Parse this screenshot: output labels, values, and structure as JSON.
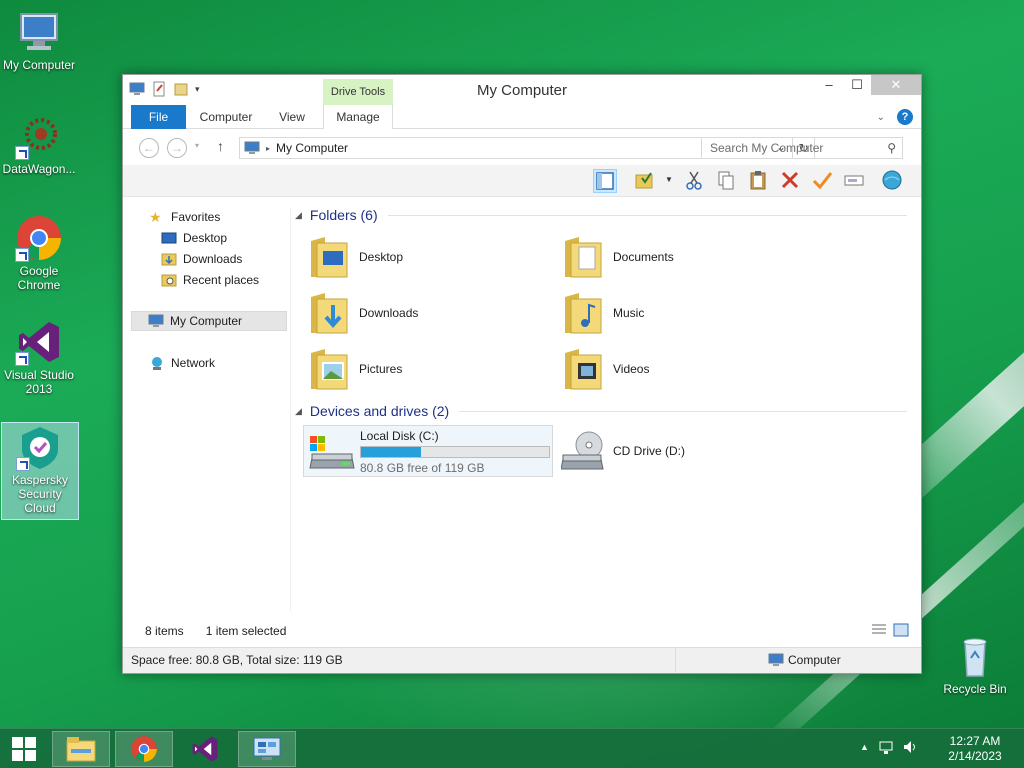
{
  "desktop": {
    "icons": [
      {
        "label": "My Computer"
      },
      {
        "label": "DataWagon..."
      },
      {
        "label": "Google Chrome"
      },
      {
        "label": "Visual Studio 2013"
      },
      {
        "label": "Kaspersky Security Cloud"
      },
      {
        "label": "Recycle Bin"
      }
    ]
  },
  "window": {
    "title": "My Computer",
    "contextual_tab_group": "Drive Tools",
    "ribbon_tabs": [
      "File",
      "Computer",
      "View",
      "Manage"
    ],
    "close_glyph": "✕",
    "maximize_glyph": "☐",
    "minimize_glyph": "–",
    "address": {
      "path": "My Computer"
    },
    "search": {
      "placeholder": "Search My Computer"
    },
    "nav": {
      "favorites": "Favorites",
      "favorites_items": [
        "Desktop",
        "Downloads",
        "Recent places"
      ],
      "my_computer": "My Computer",
      "network": "Network"
    },
    "groups": {
      "folders_header": "Folders (6)",
      "folders": [
        "Desktop",
        "Documents",
        "Downloads",
        "Music",
        "Pictures",
        "Videos"
      ],
      "devices_header": "Devices and drives (2)",
      "drives": [
        {
          "name": "Local Disk (C:)",
          "free_text": "80.8 GB free of 119 GB",
          "used_fraction": 0.32
        },
        {
          "name": "CD Drive (D:)"
        }
      ]
    },
    "status": {
      "items": "8 items",
      "selected": "1 item selected"
    },
    "details": {
      "space": "Space free: 80.8 GB, Total size: 119 GB",
      "location": "Computer"
    }
  },
  "taskbar": {
    "time": "12:27 AM",
    "date": "2/14/2023"
  },
  "colors": {
    "accent": "#1979ca",
    "progress": "#26a0da",
    "contextual_tab": "#d7f3c4"
  }
}
